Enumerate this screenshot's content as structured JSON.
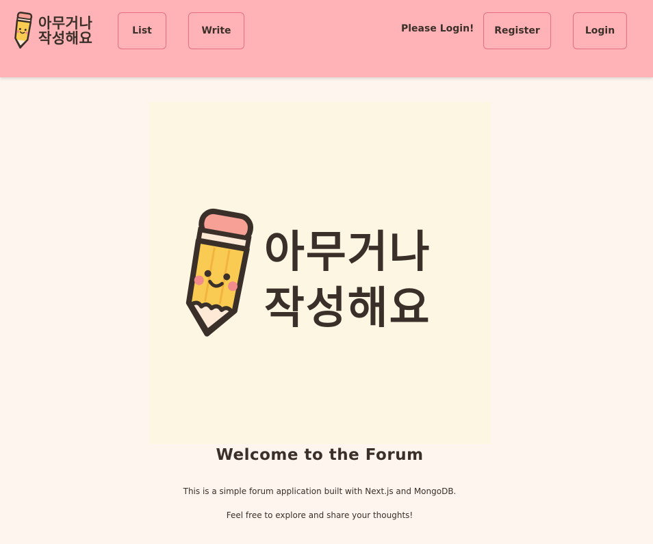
{
  "brand": {
    "line1": "아무거나",
    "line2": "작성해요",
    "logo_icon": "pencil-mascot-icon"
  },
  "nav": {
    "list_label": "List",
    "write_label": "Write",
    "login_prompt": "Please Login!",
    "register_label": "Register",
    "login_label": "Login"
  },
  "hero": {
    "line1": "아무거나",
    "line2": "작성해요",
    "icon": "pencil-mascot-icon"
  },
  "main": {
    "welcome_title": "Welcome to the Forum",
    "description_1": "This is a simple forum application built with Next.js and MongoDB.",
    "description_2": "Feel free to explore and share your thoughts!"
  },
  "colors": {
    "navbar": "#ffb3b6",
    "button_border": "#e56f7f",
    "page_background": "#fdf5ee",
    "hero_background": "#fdf6e2",
    "text": "#3b2f2a",
    "pencil_body": "#f9cb52",
    "pencil_eraser": "#f7a196"
  }
}
